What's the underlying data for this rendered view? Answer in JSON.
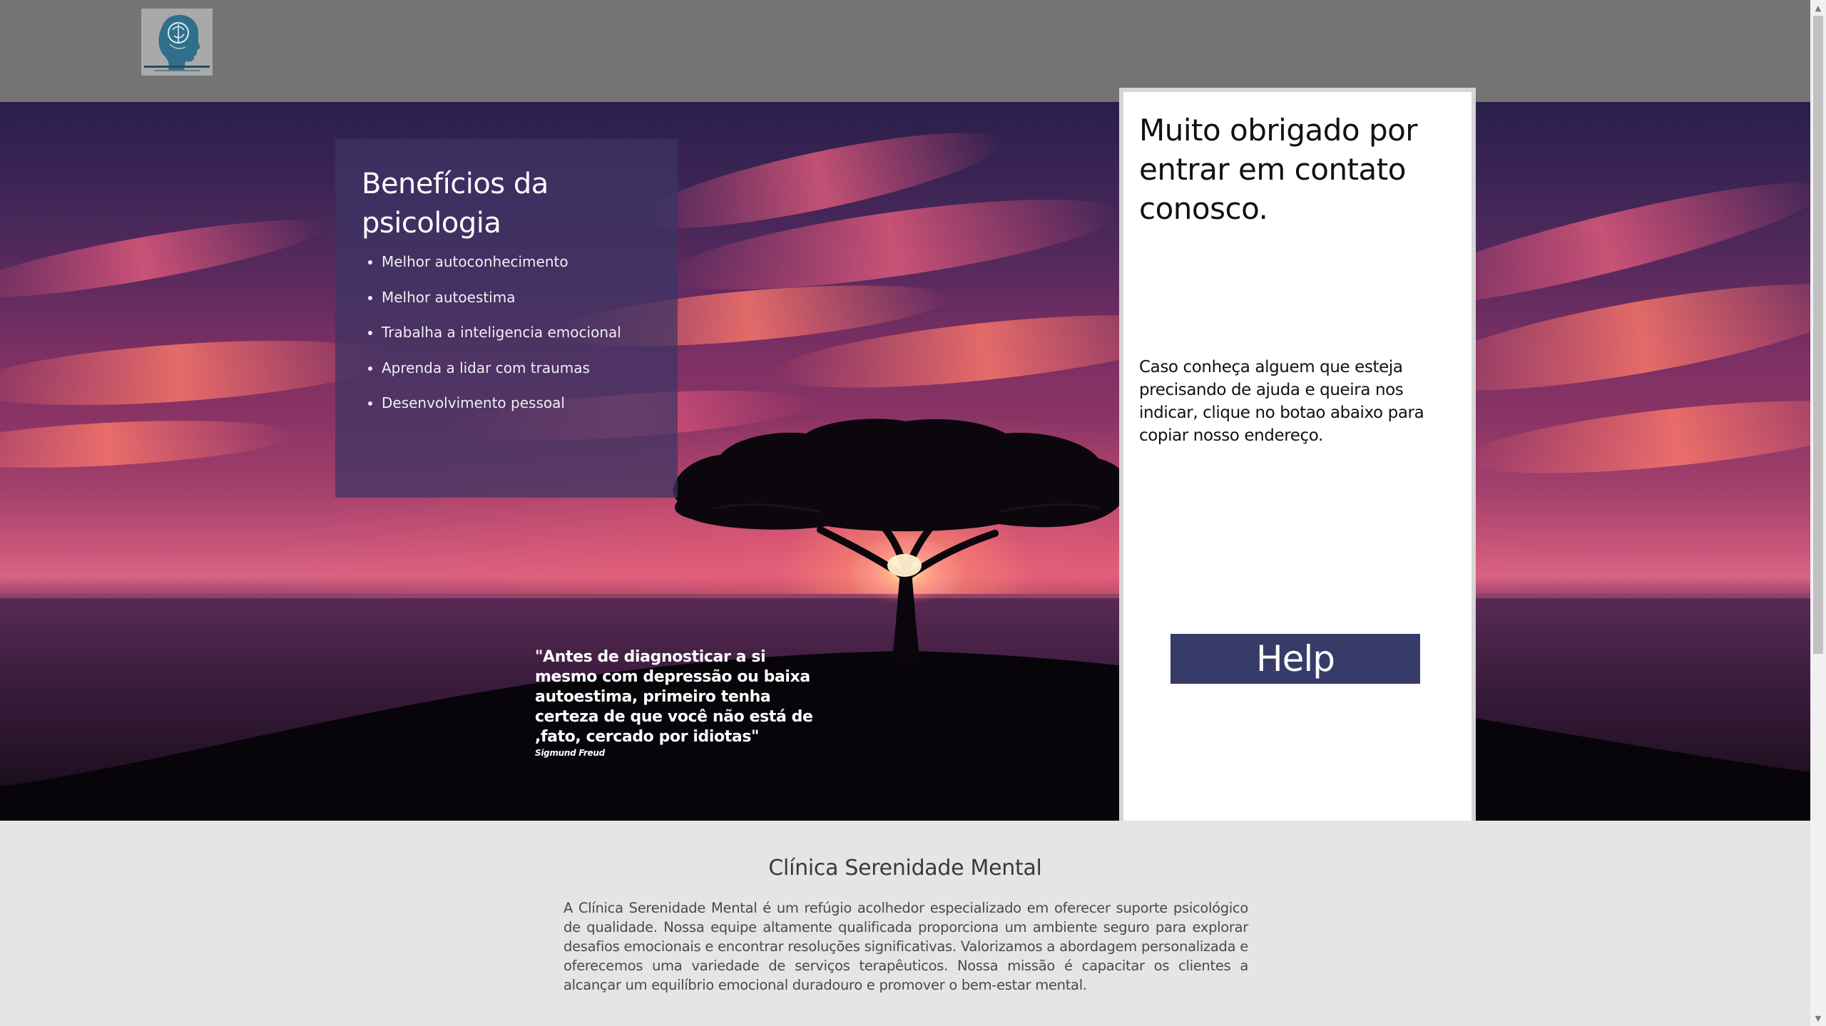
{
  "header": {
    "logo_text": "FINHAUNC CYPEATHCC"
  },
  "hero": {
    "benefits": {
      "title": "Benefícios da psicologia",
      "items": [
        "Melhor autoconhecimento",
        "Melhor autoestima",
        "Trabalha a inteligencia emocional",
        "Aprenda a lidar com traumas",
        "Desenvolvimento pessoal"
      ]
    },
    "quote": {
      "text": "\"Antes de diagnosticar a si mesmo com depressão ou baixa autoestima, primeiro tenha certeza de que você não está de ,fato, cercado por idiotas\"",
      "author": "Sigmund Freud"
    }
  },
  "contact": {
    "title": "Muito obrigado por entrar em contato conosco.",
    "text": "Caso conheça alguem que esteja precisando de ajuda e queira nos indicar, clique no botao abaixo para copiar nosso endereço.",
    "button_label": "Help"
  },
  "about": {
    "title": "Clínica Serenidade Mental",
    "text": "A Clínica Serenidade Mental é um refúgio acolhedor especializado em oferecer suporte psicológico de qualidade. Nossa equipe altamente qualificada proporciona um ambiente seguro para explorar desafios emocionais e encontrar resoluções significativas. Valorizamos a abordagem personalizada e oferecemos uma variedade de serviços terapêuticos. Nossa missão é capacitar os clientes a alcançar um equilíbrio emocional duradouro e promover o bem-estar mental."
  },
  "colors": {
    "header_bg": "#747474",
    "benefits_panel": "#3c3464",
    "button_bg": "#363b68",
    "page_bg": "#e5e5e5"
  },
  "icons": {
    "logo": "head-profile-brain-logo",
    "scroll_up": "caret-up-icon",
    "scroll_down": "caret-down-icon"
  }
}
